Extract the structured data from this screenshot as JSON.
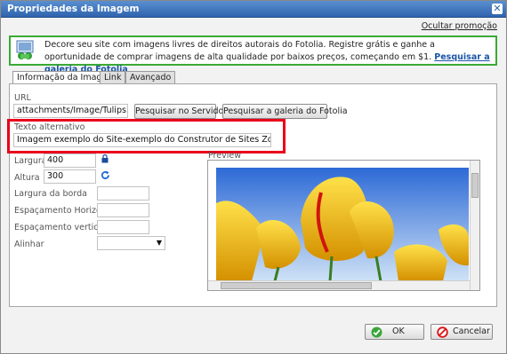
{
  "dialog": {
    "title": "Propriedades da Imagem",
    "close_icon": "close-icon"
  },
  "promo": {
    "hide_label": "Ocultar promoção",
    "text": "Decore seu site com imagens livres de direitos autorais do Fotolia. Registre grátis e ganhe a oportunidade de comprar imagens de alta qualidade por baixos preços, começando em $1.",
    "link": "Pesquisar a galeria do Fotolia",
    "icon": "fotolia-icon",
    "border_color": "#3aaa35"
  },
  "tabs": [
    {
      "label": "Informação da Imagem",
      "active": true
    },
    {
      "label": "Link",
      "active": false
    },
    {
      "label": "Avançado",
      "active": false
    }
  ],
  "form": {
    "url_label": "URL",
    "url_value": "attachments/Image/Tulips.jpg",
    "browse_server_label": "Pesquisar no Servidor",
    "browse_fotolia_label": "Pesquisar a galeria do Fotolia",
    "alt_label": "Texto alternativo",
    "alt_value": "Imagem exemplo do Site-exemplo do Construtor de Sites Zooming",
    "width_label": "Largura",
    "width_value": "400",
    "height_label": "Altura",
    "height_value": "300",
    "border_label": "Largura da borda",
    "border_value": "",
    "hspace_label": "Espaçamento Horizontal",
    "hspace_value": "",
    "vspace_label": "Espaçamento vertical",
    "vspace_value": "",
    "align_label": "Alinhar",
    "align_value": "",
    "lock_icon": "lock-icon",
    "reset_icon": "reset-size-icon"
  },
  "preview": {
    "label": "Preview"
  },
  "footer": {
    "ok_label": "OK",
    "cancel_label": "Cancelar"
  },
  "colors": {
    "title_bar": "#2f64ad",
    "highlight": "#e8001b",
    "link": "#1a55a8"
  }
}
